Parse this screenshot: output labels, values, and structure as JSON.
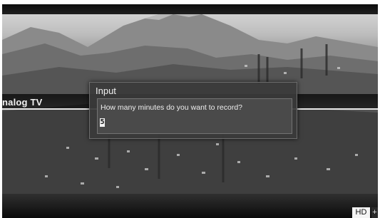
{
  "channel": {
    "label": "nalog TV"
  },
  "dialog": {
    "title": "Input",
    "prompt": "How many minutes do you want to record?",
    "value": "5"
  },
  "badges": {
    "hd": "HD",
    "extra": "+"
  },
  "icons": {
    "background": "mountain-landscape-image"
  }
}
